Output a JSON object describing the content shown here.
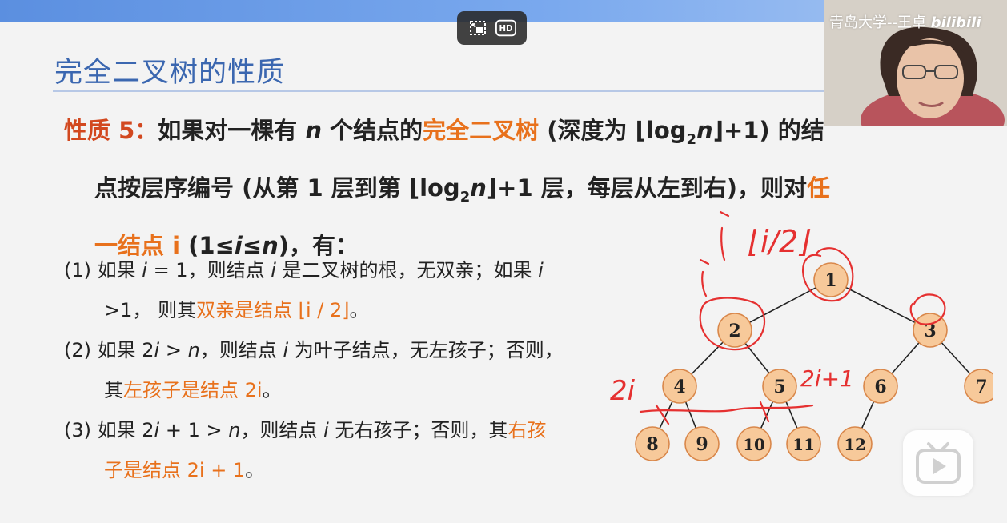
{
  "slide": {
    "title": "完全二叉树的性质",
    "prop5": {
      "label": "性质 5：",
      "l1_a": "如果对一棵有 ",
      "l1_n": "n",
      "l1_b": " 个结点的",
      "l1_hl": "完全二叉树",
      "l1_c": " (深度为 ⌊log",
      "sub2": "2",
      "l1_d": "n",
      "l1_e": "⌋+1) 的结",
      "l2_a": "点按层序编号 (从第 1 层到第 ⌊log",
      "l2_sub": "2",
      "l2_n": "n",
      "l2_b": "⌋+1 层，每层从左到右)，则对",
      "l2_hl": "任",
      "l3_hl": "一结点 i",
      "l3_a": " (1≤",
      "l3_i": "i",
      "l3_b": "≤",
      "l3_n": "n",
      "l3_c": ")，有："
    },
    "items": {
      "i1_a": "(1)  如果 ",
      "i1_i": "i",
      "i1_b": " = 1，则结点 ",
      "i1_i2": "i",
      "i1_c": " 是二叉树的根，无双亲；如果 ",
      "i1_i3": "i",
      "i1_d": ">1， 则其",
      "i1_hl": "双亲是结点 ⌊i / 2⌋",
      "i1_e": "。",
      "i2_a": "(2)  如果 2",
      "i2_i": "i",
      "i2_b": " > ",
      "i2_n": "n",
      "i2_c": "，则结点 ",
      "i2_i2": "i",
      "i2_d": " 为叶子结点，无左孩子；否则，",
      "i2_e": "其",
      "i2_hl": "左孩子是结点 2i",
      "i2_f": "。",
      "i3_a": "(3)  如果 2",
      "i3_i": "i",
      "i3_b": " + 1 > ",
      "i3_n": "n",
      "i3_c": "，则结点 ",
      "i3_i2": "i",
      "i3_d": " 无右孩子；否则，其",
      "i3_hl1": "右孩",
      "i3_hl2": "子是结点 2i + 1",
      "i3_e": "。"
    },
    "tree_nodes": [
      "1",
      "2",
      "3",
      "4",
      "5",
      "6",
      "7",
      "8",
      "9",
      "10",
      "11",
      "12"
    ],
    "annotations": {
      "top": "⌊i/2⌋",
      "left_i": "i",
      "left_2i": "2i",
      "right_2i1": "2i+1"
    }
  },
  "overlay": {
    "camera_label": "青岛大学--王卓",
    "bili_logo": "bilibili",
    "hd_label": "HD"
  },
  "colors": {
    "title": "#3b67b0",
    "highlight": "#e8711c",
    "annotation": "#e53030",
    "node_fill": "#f7c99a",
    "node_stroke": "#d9874a"
  }
}
